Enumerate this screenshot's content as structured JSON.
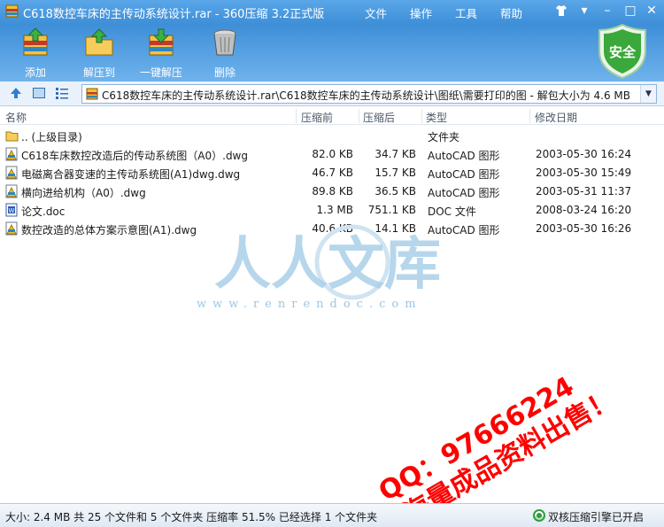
{
  "window": {
    "title": "C618数控车床的主传动系统设计.rar - 360压缩 3.2正式版",
    "menu": [
      "文件",
      "操作",
      "工具",
      "帮助"
    ]
  },
  "toolbar": {
    "add_label": "添加",
    "extract_label": "解压到",
    "oneclick_label": "一键解压",
    "delete_label": "删除",
    "safe_label": "安全"
  },
  "address": {
    "path": "C618数控车床的主传动系统设计.rar\\C618数控车床的主传动系统设计\\图纸\\需要打印的图 - 解包大小为 4.6 MB"
  },
  "columns": {
    "name": "名称",
    "packed": "压缩前",
    "size": "压缩后",
    "type": "类型",
    "modified": "修改日期"
  },
  "files": [
    {
      "name": ".. (上级目录)",
      "packed": "",
      "size": "",
      "type": "文件夹",
      "modified": "",
      "icon": "folder-icon"
    },
    {
      "name": "C618车床数控改造后的传动系统图（A0）.dwg",
      "packed": "82.0 KB",
      "size": "34.7 KB",
      "type": "AutoCAD 图形",
      "modified": "2003-05-30 16:24",
      "icon": "dwg-file-icon"
    },
    {
      "name": "电磁离合器变速的主传动系统图(A1)dwg.dwg",
      "packed": "46.7 KB",
      "size": "15.7 KB",
      "type": "AutoCAD 图形",
      "modified": "2003-05-30 15:49",
      "icon": "dwg-file-icon"
    },
    {
      "name": "横向进给机构（A0）.dwg",
      "packed": "89.8 KB",
      "size": "36.5 KB",
      "type": "AutoCAD 图形",
      "modified": "2003-05-31 11:37",
      "icon": "dwg-file-icon"
    },
    {
      "name": "论文.doc",
      "packed": "1.3 MB",
      "size": "751.1 KB",
      "type": "DOC 文件",
      "modified": "2008-03-24 16:20",
      "icon": "doc-file-icon"
    },
    {
      "name": "数控改造的总体方案示意图(A1).dwg",
      "packed": "40.6 KB",
      "size": "14.1 KB",
      "type": "AutoCAD 图形",
      "modified": "2003-05-30 16:26",
      "icon": "dwg-file-icon"
    }
  ],
  "watermark": {
    "logo_text": "人人文库",
    "url": "www.renrendoc.com",
    "ad_line1": "QQ：97666224",
    "ad_line2": "海量成品资料出售！"
  },
  "status": {
    "summary": "大小: 2.4 MB 共 25 个文件和 5 个文件夹 压缩率 51.5% 已经选择 1 个文件夹",
    "engine": "双核压缩引擎已开启"
  },
  "colors": {
    "titlebar": "#3e8fd8",
    "safe_shield": "#3aa83a",
    "watermark_blue": "#9cc7e3",
    "ad_red": "#ff0000"
  }
}
